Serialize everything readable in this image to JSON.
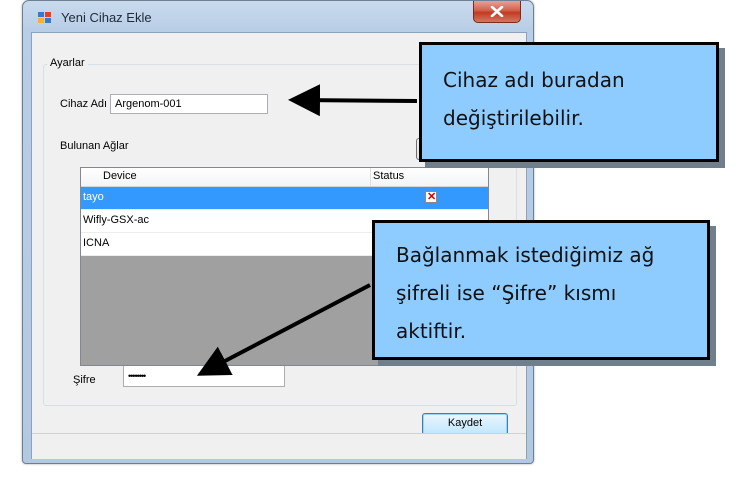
{
  "window": {
    "title": "Yeni Cihaz Ekle",
    "icon": "form-icon",
    "close_icon": "close-icon"
  },
  "settings_group": {
    "legend": "Ayarlar",
    "device_name_label": "Cihaz Adı",
    "device_name_value": "Argenom-001",
    "networks_label": "Bulunan Ağlar",
    "password_label": "Şifre",
    "password_value": "••••••••"
  },
  "network_list": {
    "columns": [
      "Device",
      "Status"
    ],
    "rows": [
      {
        "device": "tayo",
        "status_icon": "error-x-icon",
        "selected": true
      },
      {
        "device": "Wifly-GSX-ac",
        "status_icon": "",
        "selected": false
      },
      {
        "device": "ICNA",
        "status_icon": "",
        "selected": false
      }
    ]
  },
  "buttons": {
    "save_label": "Kaydet"
  },
  "callouts": {
    "device_name_note": [
      "Cihaz adı buradan",
      "değiştirilebilir."
    ],
    "password_note": [
      "Bağlanmak istediğimiz ağ",
      "şifreli ise “Şifre” kısmı",
      "aktiftir."
    ]
  },
  "colors": {
    "callout_fill": "#8ecbff",
    "selection": "#3399ff",
    "close_button": "#c23b22"
  }
}
